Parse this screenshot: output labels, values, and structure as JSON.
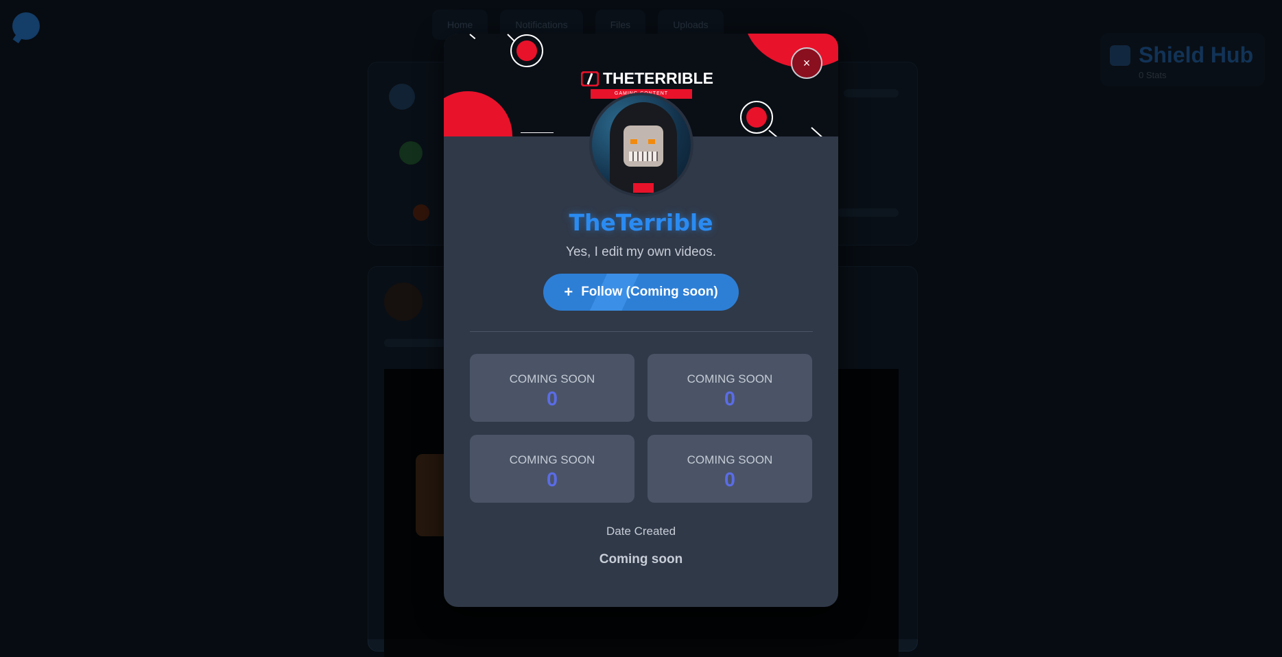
{
  "background": {
    "nav": [
      "Home",
      "Notifications",
      "Files",
      "Uploads"
    ],
    "shield_title": "Shield Hub",
    "shield_sub": "0 Stats"
  },
  "modal": {
    "close_label": "×",
    "banner": {
      "brand_text": "THETERRIBLE",
      "brand_tagline": "GAMING CONTENT"
    },
    "username": "TheTerrible",
    "bio": "Yes, I edit my own videos.",
    "follow": {
      "icon": "plus-icon",
      "label": "Follow (Coming soon)"
    },
    "stats": [
      {
        "label": "COMING SOON",
        "value": "0"
      },
      {
        "label": "COMING SOON",
        "value": "0"
      },
      {
        "label": "COMING SOON",
        "value": "0"
      },
      {
        "label": "COMING SOON",
        "value": "0"
      }
    ],
    "date_created_label": "Date Created",
    "date_created_value": "Coming soon"
  },
  "colors": {
    "accent": "#2a8bf2",
    "brand_red": "#e8122a",
    "stat_value": "#5b6ce6",
    "modal_bg": "#303948"
  }
}
